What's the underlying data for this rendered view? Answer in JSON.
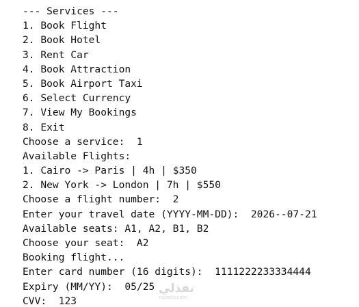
{
  "console": {
    "lines": [
      "--- Services ---",
      "1. Book Flight",
      "2. Book Hotel",
      "3. Rent Car",
      "4. Book Attraction",
      "5. Book Airport Taxi",
      "6. Select Currency",
      "7. View My Bookings",
      "8. Exit",
      "Choose a service:  1",
      "Available Flights:",
      "1. Cairo -> Paris | 4h | $350",
      "2. New York -> London | 7h | $550",
      "Choose a flight number:  2",
      "Enter your travel date (YYYY-MM-DD):  2026--07-21",
      "Available seats: A1, A2, B1, B2",
      "Choose your seat:  A2",
      "Booking flight...",
      "Enter card number (16 digits):  1111222233334444",
      "Expiry (MM/YY):  05/25",
      "CVV:  123"
    ]
  },
  "watermark": {
    "arabic": "نفذلي",
    "latin": "nafezly.com"
  }
}
